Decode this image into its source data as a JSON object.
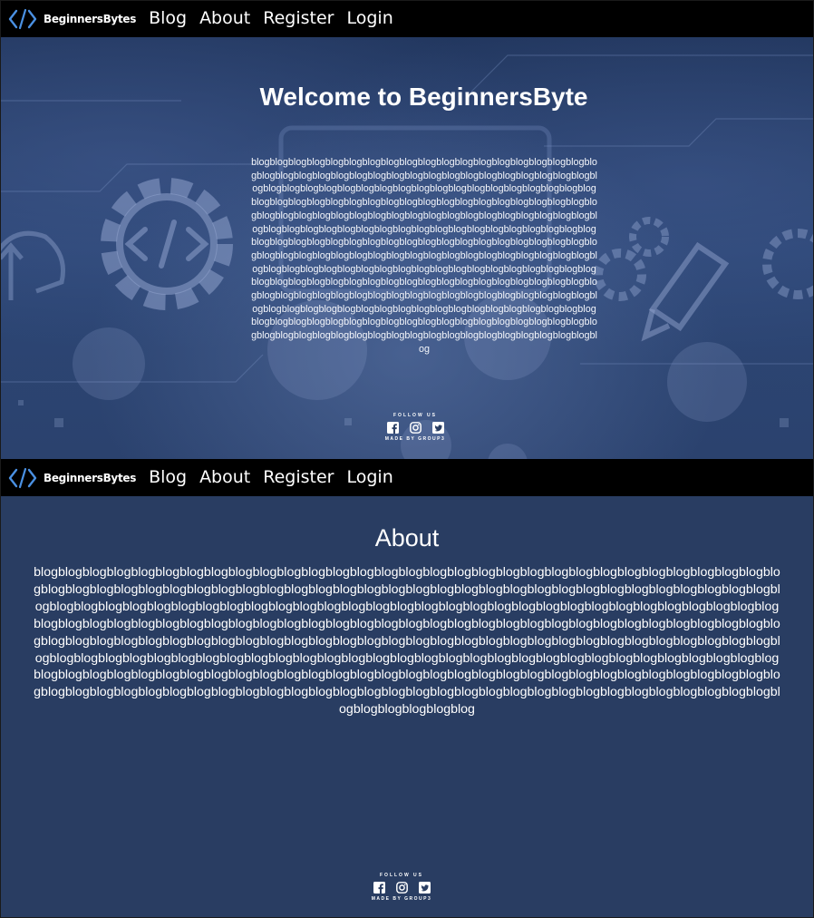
{
  "nav": {
    "brand": "BeginnersBytes",
    "links": [
      "Blog",
      "About",
      "Register",
      "Login"
    ]
  },
  "home": {
    "title": "Welcome to BeginnersByte",
    "body": "blogblogblogblogblogblogblogblogblogblogblogblogblogblogblogblogblogblogblogblogblogblogblogblogblogblogblogblogblogblogblogblogblogblogblogblogblogblogblogblogblogblogblogblogblogblogblogblogblogblogblogblogblogblogblogblogblogblogblogblogblogblogblogblogblogblogblogblogblogblogblogblogblogblogblogblogblogblogblogblogblogblogblogblogblogblogblogblogblogblogblogblogblogblogblogblogblogblogblogblogblogblogblogblogblogblogblogblogblogblogblogblogblogblogblogblogblogblogblogblogblogblogblogblogblogblogblogblogblogblogblogblogblogblogblogblogblogblogblogblogblogblogblogblogblogblogblogblogblogblogblogblogblogblogblogblogblogblogblogblogblogblogblogblogblogblogblogblogblogblogblogblogblogblogblogblogblogblogblogblogblogblogblogblogblogblogblogblogblogblogblogblogblogblogblogblogblogblogblogblogblogblogblogblogblogblogblogblogblogblogblogblogblogblogblogblogblogblogblogblogblogblogblogblogblogblogblogblogblogblogblogblogblogblogblogblogblogblogblogblogblogblogblogblogblogblogblogblogblogblogblogblogblogblogblogblogblogblogblogblogblogblog"
  },
  "about": {
    "title": "About",
    "body": "blogblogblogblogblogblogblogblogblogblogblogblogblogblogblogblogblogblogblogblogblogblogblogblogblogblogblogblogblogblogblogblogblogblogblogblogblogblogblogblogblogblogblogblogblogblogblogblogblogblogblogblogblogblogblogblogblogblogblogblogblogblogblogblogblogblogblogblogblogblogblogblogblogblogblogblogblogblogblogblogblogblogblogblogblogblogblogblogblogblogblogblogblogblogblogblogblogblogblogblogblogblogblogblogblogblogblogblogblogblogblogblogblogblogblogblogblogblogblogblogblogblogblogblogblogblogblogblogblogblogblogblogblogblogblogblogblogblogblogblogblogblogblogblogblogblogblogblogblogblogblogblogblogblogblogblogblogblogblogblogblogblogblogblogblogblogblogblogblogblogblogblogblogblogblogblogblogblogblogblogblogblogblogblogblogblogblogblogblogblogblogblogblogblogblogblogblogblogblogblogblogblogblogblogblogblogblogblogblogblogblogblogblogblogblogblogblogblogblogblogblogblogblogblogblogblogblogblogblogblogblogblogblogblogblogblogblogblogblogblogblogblogblogblogblogblogblogblogblogblogblog"
  },
  "footer": {
    "follow": "FOLLOW US",
    "made_by": "MADE BY GROUP3",
    "icons": [
      "facebook-icon",
      "instagram-icon",
      "twitter-icon"
    ]
  },
  "colors": {
    "navbar": "#000000",
    "page_bg": "#293d62",
    "brand_accent": "#4a90e2",
    "text": "#ffffff"
  }
}
